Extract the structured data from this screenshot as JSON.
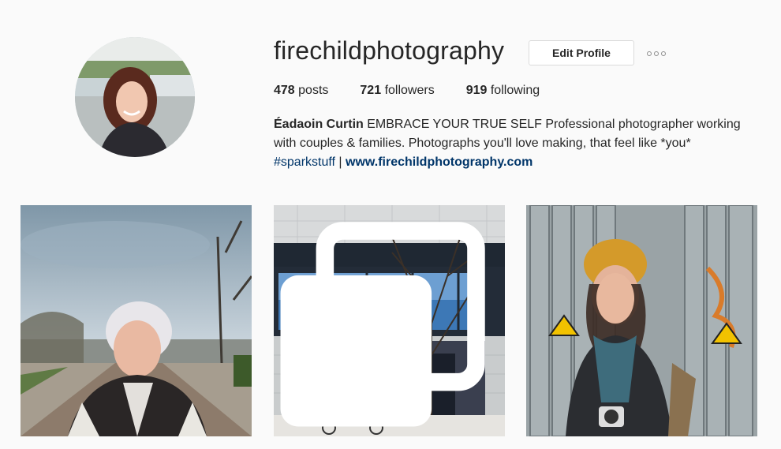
{
  "profile": {
    "username": "firechildphotography",
    "edit_label": "Edit Profile",
    "stats": {
      "posts_count": "478",
      "posts_label": "posts",
      "followers_count": "721",
      "followers_label": "followers",
      "following_count": "919",
      "following_label": "following"
    },
    "bio": {
      "name": "Éadaoin Curtin",
      "text": "EMBRACE YOUR TRUE SELF Professional photographer working with couples & families. Photographs you'll love making, that feel like *you*",
      "hashtag": "#sparkstuff",
      "separator": "|",
      "website": "www.firechildphotography.com"
    }
  },
  "posts": [
    {
      "subject": "elderly woman with white hair in a park",
      "multi": false
    },
    {
      "subject": "modern building with leafless tree",
      "multi": true,
      "icon": "multiple-photos-icon"
    },
    {
      "subject": "woman in yellow beanie in front of wooden fence",
      "multi": false
    }
  ],
  "colors": {
    "link": "#003569",
    "text": "#262626",
    "background": "#fafafa",
    "border": "#dbdbdb"
  }
}
